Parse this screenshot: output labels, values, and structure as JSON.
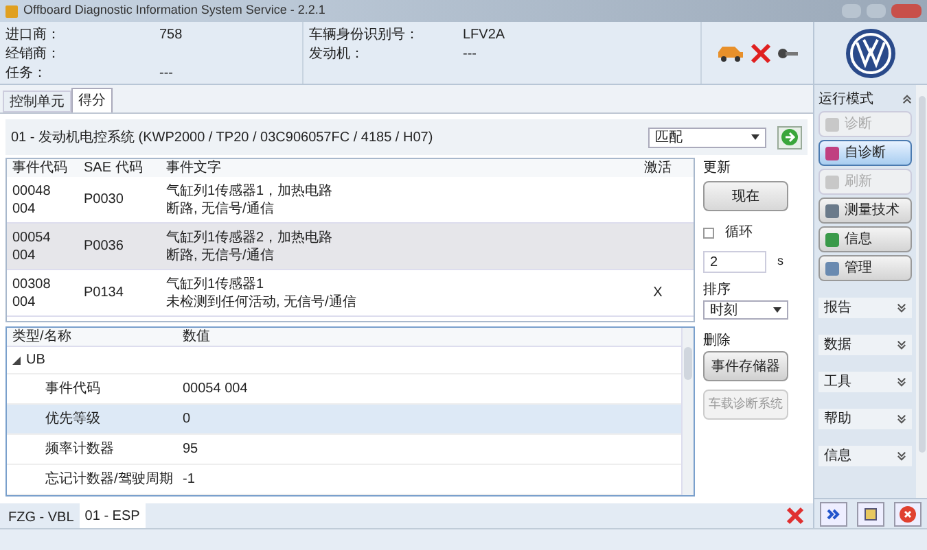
{
  "window": {
    "title": "Offboard Diagnostic Information System Service - 2.2.1"
  },
  "header": {
    "left": [
      {
        "label": "进口商：",
        "value": "758"
      },
      {
        "label": "经销商："
      },
      {
        "label": "任务：",
        "value": "---"
      }
    ],
    "right": [
      {
        "label": "车辆身份识别号：",
        "value": "LFV2A"
      },
      {
        "label": "发动机：",
        "value": "---"
      }
    ]
  },
  "tabs": [
    {
      "label": "控制单元",
      "selected": false
    },
    {
      "label": "得分",
      "selected": true
    }
  ],
  "control_unit": "01 - 发动机电控系统  (KWP2000 / TP20 / 03C906057FC  / 4185 / H07)",
  "filter": {
    "value": "匹配"
  },
  "events": {
    "columns": [
      "事件代码",
      "SAE 代码",
      "事件文字",
      "激活"
    ],
    "rows": [
      {
        "code": "00048",
        "subcode": "004",
        "sae": "P0030",
        "text1": "气缸列1传感器1，加热电路",
        "text2": "断路, 无信号/通信",
        "selected": false
      },
      {
        "code": "00054",
        "subcode": "004",
        "sae": "P0036",
        "text1": "气缸列1传感器2，加热电路",
        "text2": "断路, 无信号/通信",
        "selected": true
      },
      {
        "code": "00308",
        "subcode": "004",
        "sae": "P0134",
        "text1": "气缸列1传感器1",
        "text2": "未检测到任何活动, 无信号/通信",
        "active": "X",
        "selected": false
      }
    ]
  },
  "controls": {
    "update_label": "更新",
    "now_button": "现在",
    "loop": {
      "label": "循环",
      "checked": false
    },
    "interval": "2",
    "unit": "s",
    "sort_label": "排序",
    "sort_value": "时刻",
    "delete_label": "删除",
    "memory_button": "事件存储器",
    "obd_button": {
      "label": "车载诊断系统",
      "disabled": true
    }
  },
  "details": {
    "columns": [
      "类型/名称",
      "数值"
    ],
    "group": {
      "label": "UB",
      "expanded": true,
      "children": [
        {
          "name": "事件代码",
          "value": "00054 004",
          "selected": false
        },
        {
          "name": "优先等级",
          "value": "0",
          "selected": true
        },
        {
          "name": "频率计数器",
          "value": "95",
          "selected": false
        },
        {
          "name": "忘记计数器/驾驶周期",
          "value": "-1",
          "selected": false
        }
      ]
    }
  },
  "bottom_tabs": [
    {
      "label": "FZG - VBL",
      "selected": false
    },
    {
      "label": "01 - ESP",
      "selected": true
    }
  ],
  "sidebar": {
    "title": "运行模式",
    "modes": [
      {
        "label": "诊断",
        "disabled": true,
        "selected": false
      },
      {
        "label": "自诊断",
        "disabled": false,
        "selected": true
      },
      {
        "label": "刷新",
        "disabled": true,
        "selected": false
      },
      {
        "label": "测量技术",
        "disabled": false,
        "selected": false
      },
      {
        "label": "信息",
        "disabled": false,
        "selected": false
      },
      {
        "label": "管理",
        "disabled": false,
        "selected": false
      }
    ],
    "sections": [
      "报告",
      "数据",
      "工具",
      "帮助",
      "信息"
    ]
  }
}
